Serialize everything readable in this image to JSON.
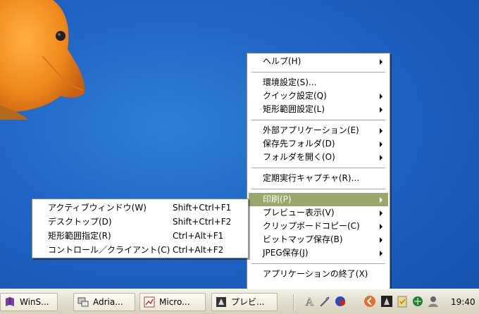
{
  "colors": {
    "desktop": "#1f63c4",
    "highlight": "#9aa86b",
    "fish_body": "#f08a1c"
  },
  "main_menu": {
    "items": [
      {
        "label": "ヘルプ(H)",
        "submenu": true
      },
      {
        "separator": true
      },
      {
        "label": "環境設定(S)...",
        "submenu": false
      },
      {
        "label": "クイック設定(Q)",
        "submenu": true
      },
      {
        "label": "矩形範囲設定(L)",
        "submenu": true
      },
      {
        "separator": true
      },
      {
        "label": "外部アプリケーション(E)",
        "submenu": true
      },
      {
        "label": "保存先フォルダ(D)",
        "submenu": true
      },
      {
        "label": "フォルダを開く(O)",
        "submenu": true
      },
      {
        "separator": true
      },
      {
        "label": "定期実行キャプチャ(R)...",
        "submenu": false
      },
      {
        "separator": true
      },
      {
        "label": "印刷(P)",
        "submenu": true,
        "highlighted": true
      },
      {
        "label": "プレビュー表示(V)",
        "submenu": true
      },
      {
        "label": "クリップボードコピー(C)",
        "submenu": true
      },
      {
        "label": "ビットマップ保存(B)",
        "submenu": true
      },
      {
        "label": "JPEG保存(J)",
        "submenu": true
      },
      {
        "separator": true
      },
      {
        "label": "アプリケーションの終了(X)",
        "submenu": false
      }
    ]
  },
  "print_submenu": {
    "items": [
      {
        "label": "アクティブウィンドウ(W)",
        "shortcut": "Shift+Ctrl+F1"
      },
      {
        "label": "デスクトップ(D)",
        "shortcut": "Shift+Ctrl+F2"
      },
      {
        "label": "矩形範囲指定(R)",
        "shortcut": "Ctrl+Alt+F1"
      },
      {
        "label": "コントロール／クライアント(C)",
        "shortcut": "Ctrl+Alt+F2"
      }
    ]
  },
  "taskbar": {
    "tasks": [
      {
        "label": "WinS...",
        "icon": "book-icon"
      },
      {
        "label": "Adria...",
        "icon": "network-icon"
      },
      {
        "label": "Micro...",
        "icon": "chart-icon"
      },
      {
        "label": "プレビ...",
        "icon": "capture-icon"
      }
    ],
    "tray": {
      "clock": "19:40",
      "icons": [
        "ime-a-icon",
        "tools-icon",
        "globe-icon",
        "back-arrow-icon",
        "capture-tray-icon",
        "clipboard-icon",
        "network-status-icon",
        "user-icon"
      ]
    }
  }
}
